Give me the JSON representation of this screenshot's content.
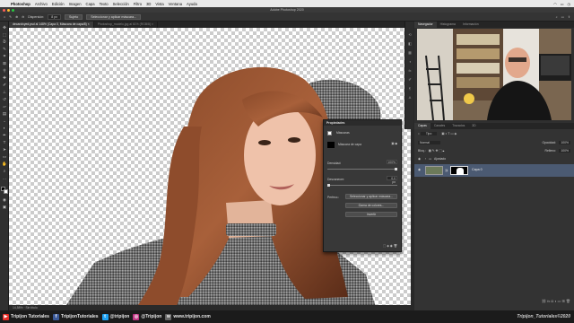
{
  "menubar": {
    "app_name": "Photoshop",
    "items": [
      "Archivo",
      "Edición",
      "Imagen",
      "Capa",
      "Texto",
      "Selección",
      "Filtro",
      "3D",
      "Vista",
      "Ventana",
      "Ayuda"
    ],
    "right_icons": [
      "wifi-icon",
      "battery-icon",
      "clock-icon"
    ]
  },
  "window": {
    "title": "Adobe Photoshop 2020"
  },
  "options_bar": {
    "dispersion_label": "Dispersión:",
    "dispersion_value": "8 px",
    "subject_button": "Sujeto",
    "select_mask_button": "Seleccionar y aplicar máscara..."
  },
  "doc_tabs": [
    {
      "label": "decarolxyed.psd al 148% (Capa 0, Máscara de capa/8)",
      "active": true
    },
    {
      "label": "Photoshop_modelo.jpg al 61% (RGB/8)",
      "active": false
    }
  ],
  "status": {
    "text": "14,58% · Sin título"
  },
  "properties": {
    "title": "Propiedades",
    "section_label": "Máscaras",
    "mask_type": "Máscara de capa",
    "density_label": "Densidad:",
    "density_value": "100%",
    "feather_label": "Desvanecer:",
    "feather_value": "0,0 px",
    "refine_label": "Perfecc.:",
    "select_mask_button": "Seleccionar y aplicar máscara...",
    "color_range_button": "Gama de colores...",
    "invert_button": "Invertir",
    "density_level": 1.0,
    "feather_level": 0.0
  },
  "right_panels": {
    "top_tabs": [
      "Navegador",
      "Histograma",
      "Información"
    ],
    "layer_tabs": [
      "Capas",
      "Canales",
      "Trazados",
      "3D"
    ],
    "kind_label": "Tipo",
    "blend_mode": "Normal",
    "opacity_label": "Opacidad:",
    "opacity_value": "100%",
    "fill_label": "Relleno:",
    "fill_value": "100%",
    "lock_label": "Bloq.:",
    "group_name": "Ajustado",
    "layer_name": "Capa 0"
  },
  "footer": {
    "items": [
      {
        "icon": "youtube-icon",
        "text": "Tripijon Tutoriales",
        "color": "#e52d27"
      },
      {
        "icon": "facebook-icon",
        "text": "TripijonTutoriales",
        "color": "#3b5998"
      },
      {
        "icon": "twitter-icon",
        "text": "@tripijon",
        "color": "#1da1f2"
      },
      {
        "icon": "instagram-icon",
        "text": "@Tripijon",
        "color": "#c13584"
      },
      {
        "icon": "web-icon",
        "text": "www.tripijon.com",
        "color": "#666666"
      }
    ],
    "brand": "Tripijon_Tutoriales©2020"
  },
  "colors": {
    "accent_selected_layer": "#4b5a72",
    "panel_bg": "#2f2f2f",
    "menubar_bg": "#e9e9e9"
  }
}
